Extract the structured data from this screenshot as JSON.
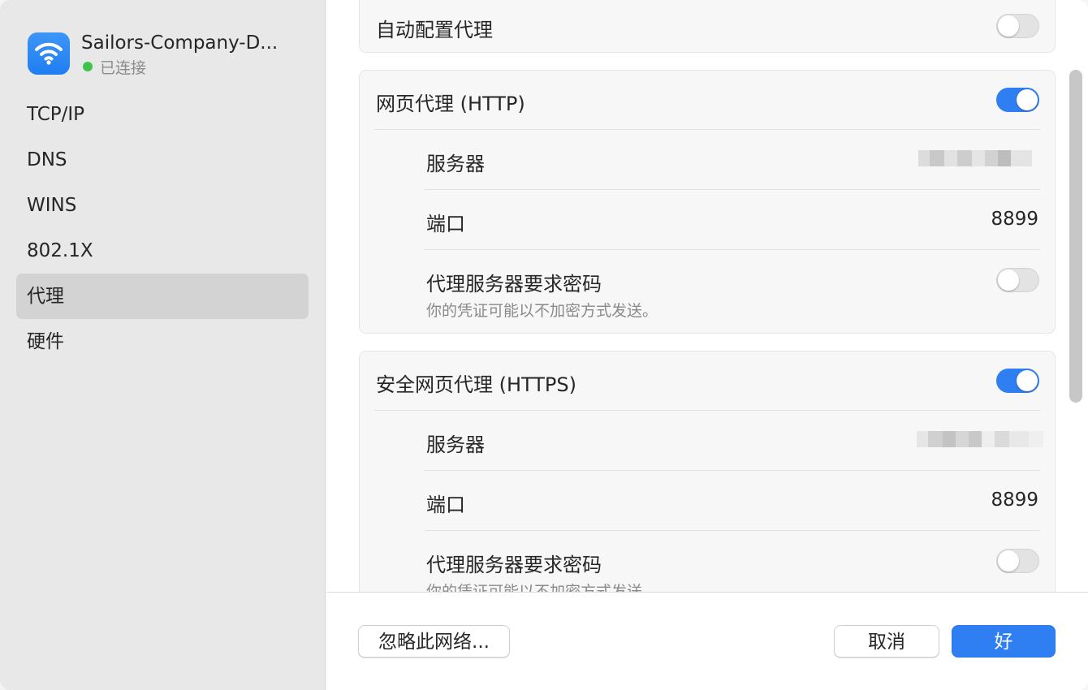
{
  "sidebar": {
    "network": {
      "icon": "wifi-icon",
      "name": "Sailors-Company-D...",
      "status": "已连接",
      "status_color": "#3fc24b"
    },
    "items": [
      {
        "label": "TCP/IP"
      },
      {
        "label": "DNS"
      },
      {
        "label": "WINS"
      },
      {
        "label": "802.1X"
      },
      {
        "label": "代理",
        "selected": true
      },
      {
        "label": "硬件"
      }
    ]
  },
  "main": {
    "auto_proxy": {
      "label": "自动配置代理",
      "enabled": false
    },
    "http_proxy": {
      "label": "网页代理 (HTTP)",
      "enabled": true,
      "server_label": "服务器",
      "server_value_obscured": true,
      "port_label": "端口",
      "port_value": "8899",
      "auth_label": "代理服务器要求密码",
      "auth_note": "你的凭证可能以不加密方式发送。",
      "auth_enabled": false
    },
    "https_proxy": {
      "label": "安全网页代理 (HTTPS)",
      "enabled": true,
      "server_label": "服务器",
      "server_value_obscured": true,
      "port_label": "端口",
      "port_value": "8899",
      "auth_label": "代理服务器要求密码",
      "auth_note": "你的凭证可能以不加密方式发送。",
      "auth_enabled": false
    }
  },
  "footer": {
    "ignore_network": "忽略此网络...",
    "cancel": "取消",
    "ok": "好"
  },
  "colors": {
    "accent": "#2f7ff3",
    "sidebar_bg": "#e8e8e8",
    "selected_bg": "#d3d3d3"
  }
}
